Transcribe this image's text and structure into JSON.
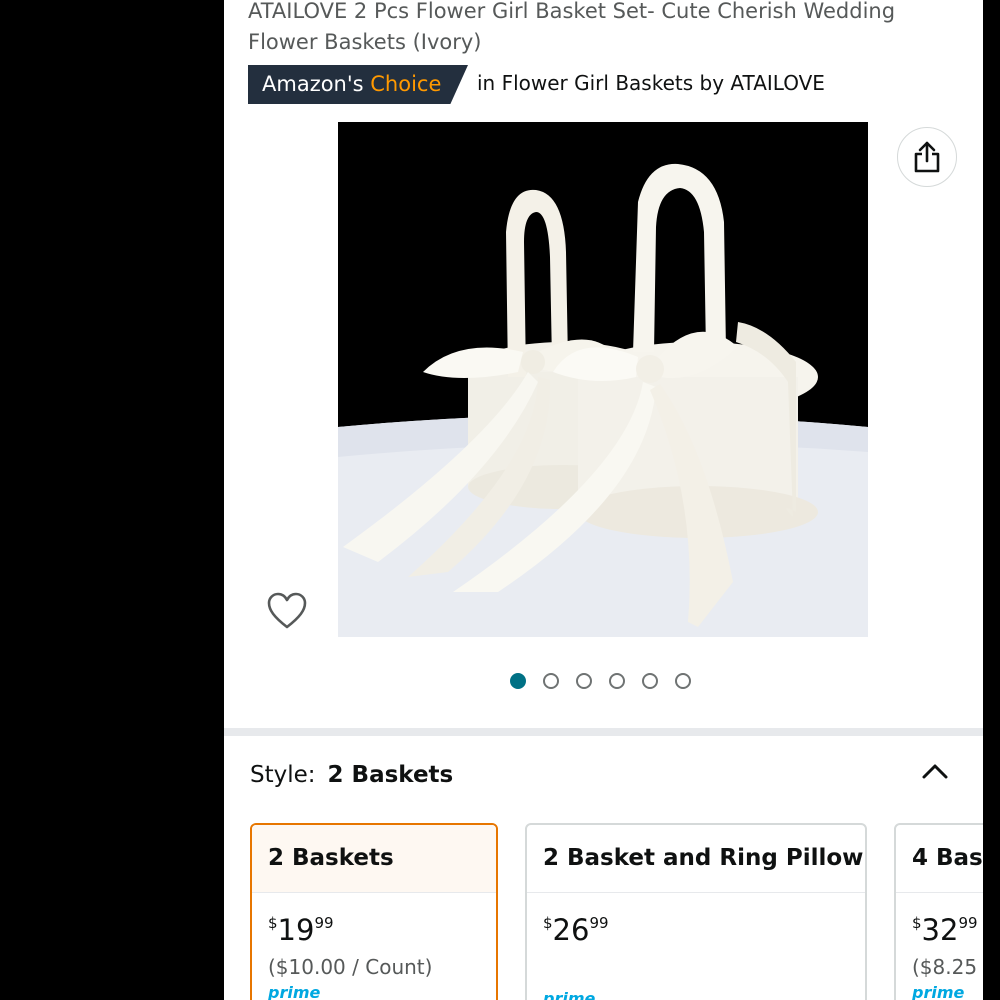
{
  "product": {
    "title": "ATAILOVE 2 Pcs Flower Girl Basket Set- Cute Cherish Wedding Flower Baskets (Ivory)",
    "badge_prefix": "Amazon's ",
    "badge_accent": "Choice",
    "badge_category": "in Flower Girl Baskets by ATAILOVE"
  },
  "gallery": {
    "image_count": 6,
    "active_index": 0,
    "share_icon": "share-icon",
    "wishlist_icon": "heart-outline-icon"
  },
  "style_selector": {
    "label": "Style:",
    "selected_value": "2 Baskets",
    "toggle_icon": "chevron-up-icon",
    "options": [
      {
        "name": "2 Baskets",
        "price_symbol": "$",
        "price_whole": "19",
        "price_fraction": "99",
        "unit_price": "($10.00 / Count)",
        "prime": "prime",
        "selected": true
      },
      {
        "name": "2 Basket and Ring Pillow",
        "price_symbol": "$",
        "price_whole": "26",
        "price_fraction": "99",
        "unit_price": "",
        "prime": "prime",
        "selected": false
      },
      {
        "name": "4 Bas",
        "price_symbol": "$",
        "price_whole": "32",
        "price_fraction": "99",
        "unit_price": "($8.25",
        "prime": "prime",
        "selected": false
      }
    ]
  },
  "colors": {
    "accent_orange": "#ff9900",
    "badge_bg": "#232f3e",
    "dot_active": "#007185",
    "selected_border": "#e77600"
  }
}
